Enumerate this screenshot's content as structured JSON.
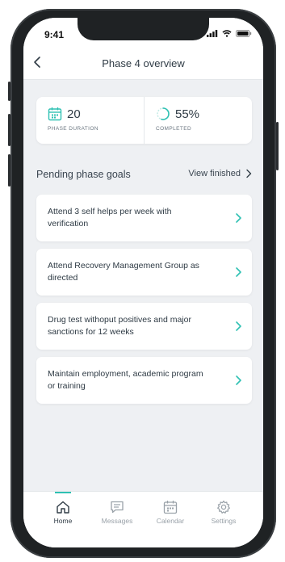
{
  "status_bar": {
    "time": "9:41"
  },
  "header": {
    "title": "Phase 4 overview"
  },
  "stats": [
    {
      "value": "20",
      "label": "PHASE DURATION",
      "icon": "calendar-icon"
    },
    {
      "value": "55%",
      "label": "COMPLETED",
      "icon": "progress-ring-icon",
      "progress": 0.55
    }
  ],
  "section": {
    "title": "Pending phase goals",
    "view_finished": "View finished"
  },
  "goals": [
    {
      "text": "Attend 3 self helps per week with verification"
    },
    {
      "text": "Attend Recovery Management Group as directed"
    },
    {
      "text": "Drug test withoput positives and major sanctions for 12 weeks"
    },
    {
      "text": "Maintain employment, academic program or training"
    }
  ],
  "tabs": [
    {
      "label": "Home",
      "icon": "home-icon",
      "active": true
    },
    {
      "label": "Messages",
      "icon": "chat-icon",
      "active": false
    },
    {
      "label": "Calendar",
      "icon": "calendar-icon",
      "active": false
    },
    {
      "label": "Settings",
      "icon": "gear-icon",
      "active": false
    }
  ],
  "colors": {
    "accent": "#2fc1b3",
    "background": "#eef0f3",
    "text": "#2f3b45"
  }
}
